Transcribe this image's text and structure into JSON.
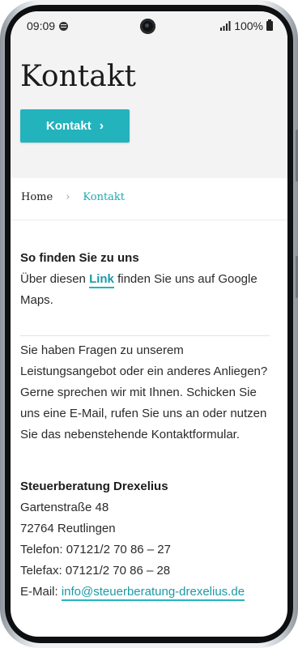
{
  "status_bar": {
    "time": "09:09",
    "battery": "100%",
    "icons": [
      "spotify-icon",
      "signal-icon",
      "battery-icon"
    ]
  },
  "hero": {
    "title": "Kontakt",
    "button_label": "Kontakt",
    "button_icon": "chevron-right-icon",
    "accent_color": "#23b3bd",
    "background": "#f3f3f3"
  },
  "breadcrumb": {
    "home": "Home",
    "separator": "›",
    "current": "Kontakt"
  },
  "find_us": {
    "heading": "So finden Sie zu uns",
    "text_before": "Über diesen ",
    "link_label": "Link",
    "text_after": " finden Sie uns auf Google Maps."
  },
  "questions": {
    "text": "Sie haben Fragen zu unserem Leistungsangebot oder ein anderes Anliegen? Gerne sprechen wir mit Ihnen. Schicken Sie uns eine E-Mail, rufen Sie uns an oder nutzen Sie das nebenstehende Kontaktformular."
  },
  "address": {
    "company": "Steuerberatung Drexelius",
    "street": "Gartenstraße 48",
    "city": "72764 Reutlingen",
    "phone": "Telefon: 07121/2 70 86 – 27",
    "fax": "Telefax: 07121/2 70 86 – 28",
    "email_label": "E-Mail: ",
    "email": "info@steuerberatung-drexelius.de"
  }
}
